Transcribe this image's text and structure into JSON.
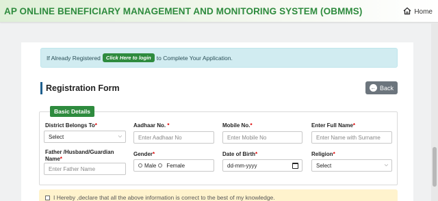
{
  "header": {
    "title": "AP ONLINE BENEFICIARY MANAGEMENT AND MONITORING SYSTEM (OBMMS)",
    "home_label": "Home"
  },
  "alert": {
    "prefix": "If Already Registered",
    "login_label": "Click Here to login",
    "suffix": "to Complete Your Application."
  },
  "form": {
    "title": "Registration Form",
    "back_label": "Back",
    "section_label": "Basic Details",
    "fields": {
      "district": {
        "label": "District Belongs To",
        "required": "*",
        "value": "Select"
      },
      "aadhaar": {
        "label": "Aadhaar No.",
        "required": "*",
        "placeholder": "Enter Aadhaar No"
      },
      "mobile": {
        "label": "Mobile No.",
        "required": "*",
        "placeholder": "Enter Mobile No"
      },
      "fullname": {
        "label": "Enter Full Name",
        "required": "*",
        "placeholder": "Enter Name with Surname"
      },
      "father": {
        "label_line1": "Father /Husband/Guardian",
        "label_line2": "Name",
        "required": "*",
        "placeholder": "Enter Father Name"
      },
      "gender": {
        "label": "Gender",
        "required": "*",
        "options": [
          "Male",
          "Female"
        ]
      },
      "dob": {
        "label": "Date of Birth",
        "required": "*",
        "value": "dd-mm-yyyy"
      },
      "religion": {
        "label": "Religion",
        "required": "*",
        "value": "Select"
      }
    },
    "declaration": "I Hereby ,declare that all the above information is correct to the best of my knowledge."
  },
  "colors": {
    "brand_green": "#2e8b3e",
    "alert_bg": "#d1ecf1",
    "back_button": "#6c757d",
    "declaration_bg": "#fff3cd"
  }
}
